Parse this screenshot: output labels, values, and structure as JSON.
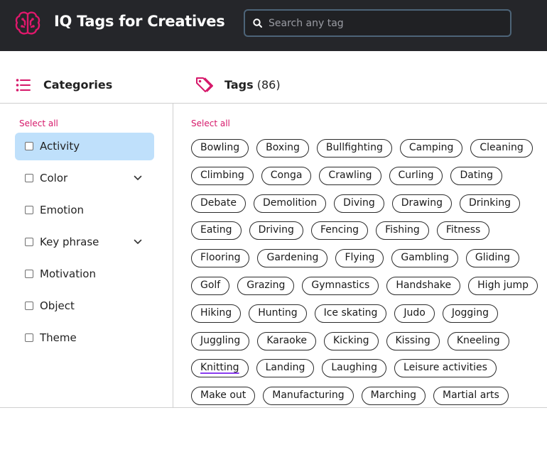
{
  "header": {
    "title": "IQ Tags for Creatives",
    "brand_icon": "brain-icon",
    "brand_color": "#e0186c",
    "search": {
      "placeholder": "Search any tag",
      "value": ""
    }
  },
  "categories": {
    "title": "Categories",
    "select_all": "Select all",
    "items": [
      {
        "label": "Activity",
        "active": true,
        "expandable": false
      },
      {
        "label": "Color",
        "active": false,
        "expandable": true
      },
      {
        "label": "Emotion",
        "active": false,
        "expandable": false
      },
      {
        "label": "Key phrase",
        "active": false,
        "expandable": true
      },
      {
        "label": "Motivation",
        "active": false,
        "expandable": false
      },
      {
        "label": "Object",
        "active": false,
        "expandable": false
      },
      {
        "label": "Theme",
        "active": false,
        "expandable": false
      }
    ]
  },
  "tags": {
    "title": "Tags",
    "count": "(86)",
    "select_all": "Select all",
    "hovered": "Knitting",
    "rows": [
      [
        "Bowling",
        "Boxing",
        "Bullfighting",
        "Camping",
        "Cleaning"
      ],
      [
        "Climbing",
        "Conga",
        "Crawling",
        "Curling",
        "Dating"
      ],
      [
        "Debate",
        "Demolition",
        "Diving",
        "Drawing",
        "Drinking"
      ],
      [
        "Eating",
        "Driving",
        "Fencing",
        "Fishing",
        "Fitness"
      ],
      [
        "Flooring",
        "Gardening",
        "Flying",
        "Gambling",
        "Gliding"
      ],
      [
        "Golf",
        "Grazing",
        "Gymnastics",
        "Handshake",
        "High jump"
      ],
      [
        "Hiking",
        "Hunting",
        "Ice skating",
        "Judo",
        "Jogging"
      ],
      [
        "Juggling",
        "Karaoke",
        "Kicking",
        "Kissing",
        "Kneeling"
      ],
      [
        "Knitting",
        "Landing",
        "Laughing",
        "Leisure activities"
      ],
      [
        "Make out",
        "Manufacturing",
        "Marching",
        "Martial arts"
      ]
    ]
  },
  "colors": {
    "accent": "#d6186a",
    "active_category": "#bfe0fb",
    "topbar": "#25262a"
  }
}
